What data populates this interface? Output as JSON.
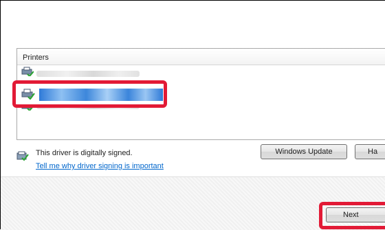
{
  "printers": {
    "header": "Printers"
  },
  "signing": {
    "status_text": "This driver is digitally signed.",
    "help_link": "Tell me why driver signing is important"
  },
  "buttons": {
    "windows_update": "Windows Update",
    "have_disk": "Ha",
    "next": "Next"
  },
  "colors": {
    "highlight": "#e21a36",
    "selection": "#3d87db",
    "link": "#0066cc"
  }
}
